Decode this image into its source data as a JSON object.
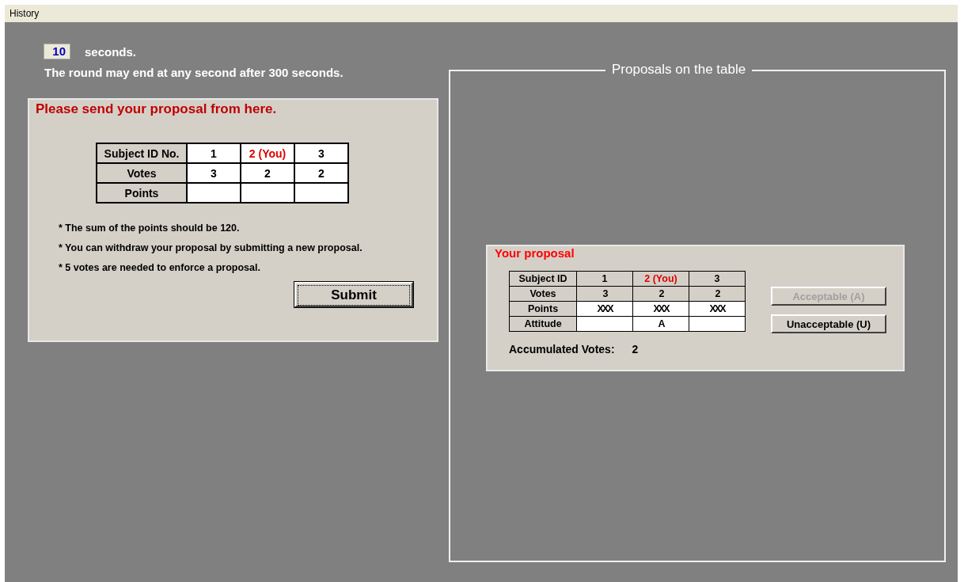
{
  "menu": [
    {
      "label": "History"
    }
  ],
  "timer": {
    "value": "10",
    "unit": "seconds."
  },
  "notice": "The round may end at any second after 300 seconds.",
  "send_panel": {
    "title": "Please send your proposal from here.",
    "columns": [
      {
        "text": "1",
        "you": false
      },
      {
        "text": "2 (You)",
        "you": true
      },
      {
        "text": "3",
        "you": false
      }
    ],
    "header_label": "Subject ID No.",
    "rows": [
      {
        "label": "Votes",
        "kind": "text",
        "cells": [
          "3",
          "2",
          "2"
        ]
      },
      {
        "label": "Points",
        "kind": "input"
      }
    ],
    "notes": [
      "* The sum of the points should be 120.",
      "* You can withdraw your proposal by submitting a new proposal.",
      "* 5 votes are needed to enforce a proposal."
    ],
    "submit": "Submit"
  },
  "table_frame": {
    "title": "Proposals on the table",
    "proposal": {
      "title": "Your proposal",
      "header_label": "Subject ID",
      "columns": [
        {
          "text": "1",
          "you": false
        },
        {
          "text": "2 (You)",
          "you": true
        },
        {
          "text": "3",
          "you": false
        }
      ],
      "rows": [
        {
          "label": "Votes",
          "kind": "shaded",
          "cells": [
            "3",
            "2",
            "2"
          ]
        },
        {
          "label": "Points",
          "kind": "plain",
          "cells": [
            "XXX",
            "XXX",
            "XXX"
          ]
        },
        {
          "label": "Attitude",
          "kind": "plain",
          "cells": [
            "",
            "A",
            ""
          ]
        }
      ],
      "accumulated_label": "Accumulated Votes:",
      "accumulated_value": "2",
      "buttons": [
        {
          "label": "Acceptable (A)",
          "disabled": true
        },
        {
          "label": "Unacceptable (U)",
          "disabled": false
        }
      ]
    }
  }
}
